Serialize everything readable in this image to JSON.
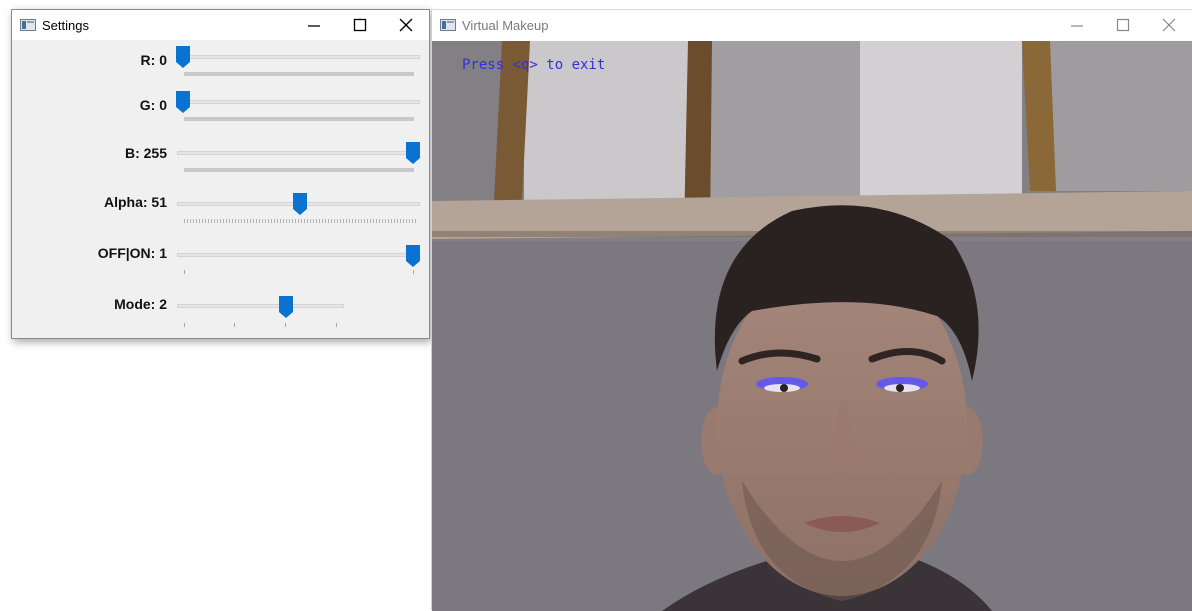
{
  "settings_window": {
    "title": "Settings",
    "trackbars": [
      {
        "label": "R: 0",
        "value": 0,
        "max": 255
      },
      {
        "label": "G: 0",
        "value": 0,
        "max": 255
      },
      {
        "label": "B: 255",
        "value": 255,
        "max": 255
      },
      {
        "label": "Alpha: 51",
        "value": 51,
        "max": 100
      },
      {
        "label": "OFF|ON: 1",
        "value": 1,
        "max": 1
      },
      {
        "label": "Mode: 2",
        "value": 2,
        "max": 3
      }
    ]
  },
  "makeup_window": {
    "title": "Virtual Makeup",
    "overlay_text": "Press <q> to exit"
  },
  "colors": {
    "thumb": "#0a73d1",
    "overlay_text": "#2f2fe0",
    "eyeliner": "#5a52ff"
  },
  "icons": [
    "minimize-icon",
    "maximize-icon",
    "close-icon",
    "app-icon"
  ]
}
